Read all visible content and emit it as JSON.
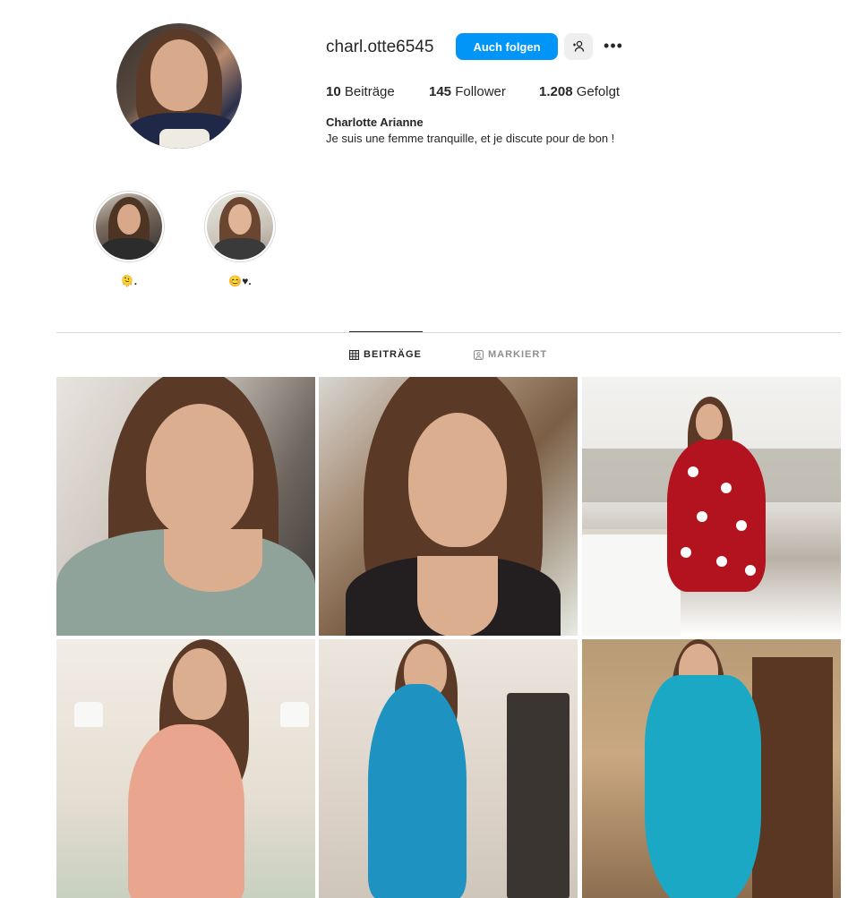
{
  "profile": {
    "username": "charl.otte6545",
    "follow_label": "Auch folgen",
    "more_label": "•••",
    "suggest_icon": "person-plus-icon",
    "full_name": "Charlotte Arianne",
    "bio": "Je suis une femme tranquille, et je discute pour de bon !",
    "stats": [
      {
        "count": "10",
        "label": "Beiträge"
      },
      {
        "count": "145",
        "label": "Follower"
      },
      {
        "count": "1.208",
        "label": "Gefolgt"
      }
    ]
  },
  "highlights": [
    {
      "label": "🫠."
    },
    {
      "label": "😊♥."
    }
  ],
  "tabs": [
    {
      "label": "BEITRÄGE",
      "icon": "grid-icon",
      "active": true
    },
    {
      "label": "MARKIERT",
      "icon": "tagged-icon",
      "active": false
    }
  ],
  "colors": {
    "accent": "#0095f6",
    "text": "#262626",
    "muted": "#8e8e8e",
    "divider": "#dbdbdb"
  }
}
